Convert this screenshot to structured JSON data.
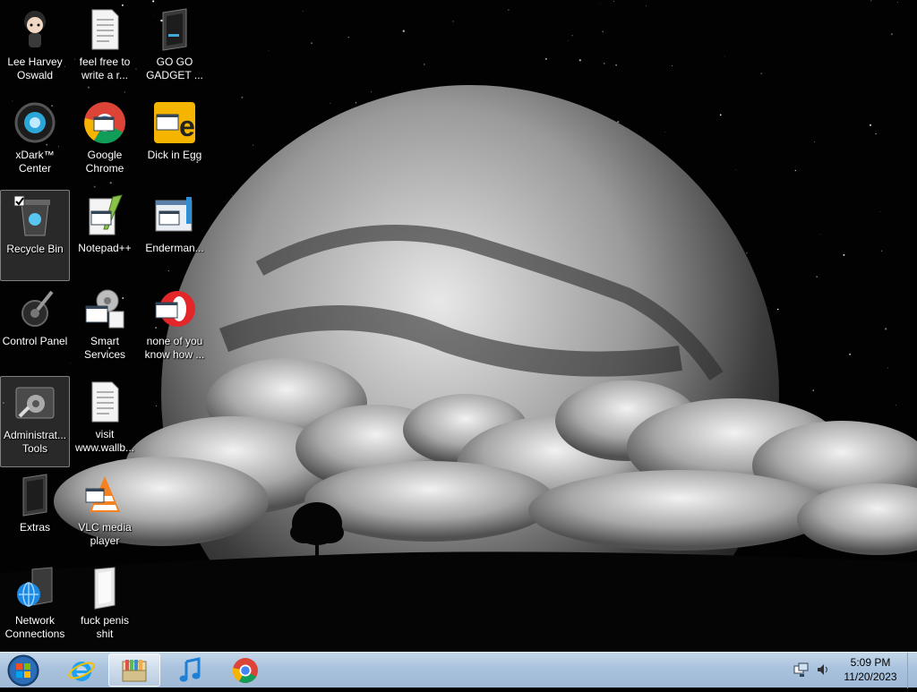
{
  "desktop": {
    "icons": [
      {
        "label": "Lee Harvey Oswald",
        "icon": "character-icon"
      },
      {
        "label": "feel free to write a r...",
        "icon": "text-document-icon"
      },
      {
        "label": "GO GO GADGET ...",
        "icon": "folder-icon"
      },
      {
        "label": "xDark™ Center",
        "icon": "xdark-icon"
      },
      {
        "label": "Google Chrome",
        "icon": "chrome-icon"
      },
      {
        "label": "Dick in Egg",
        "icon": "egg-app-icon"
      },
      {
        "label": "Recycle Bin",
        "icon": "recycle-bin-icon"
      },
      {
        "label": "Notepad++",
        "icon": "notepadpp-icon"
      },
      {
        "label": "Enderman...",
        "icon": "window-shortcut-icon"
      },
      {
        "label": "Control Panel",
        "icon": "control-panel-icon"
      },
      {
        "label": "Smart Services",
        "icon": "services-icon"
      },
      {
        "label": "none of you know how ...",
        "icon": "opera-shortcut-icon"
      },
      {
        "label": "Administrat... Tools",
        "icon": "admin-tools-icon"
      },
      {
        "label": "visit www.wallb...",
        "icon": "text-document-icon"
      },
      {
        "label": "Extras",
        "icon": "folder-icon"
      },
      {
        "label": "VLC media player",
        "icon": "vlc-icon"
      },
      {
        "label": "Network Connections",
        "icon": "network-icon"
      },
      {
        "label": "fuck penis shit",
        "icon": "text-document-icon"
      }
    ]
  },
  "taskbar": {
    "pinned": [
      "internet-explorer-icon",
      "windows-explorer-icon",
      "itunes-icon",
      "chrome-icon"
    ],
    "active_item": "windows-explorer-icon",
    "clock_time": "5:09 PM",
    "clock_date": "11/20/2023"
  },
  "colors": {
    "taskbar": "#a9c2dd",
    "selection": "#7d7d7d"
  }
}
